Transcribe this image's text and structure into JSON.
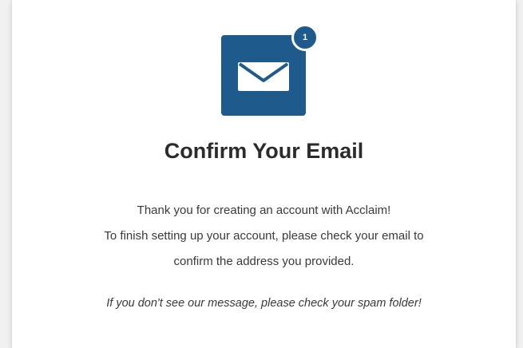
{
  "notification": {
    "icon": "envelope-icon",
    "badge_count": "1",
    "accent_color": "#1e5b8c"
  },
  "heading": "Confirm Your Email",
  "message_lines": [
    "Thank you for creating an account with Acclaim!",
    "To finish setting up your account, please check your email to",
    "confirm the address you provided."
  ],
  "spam_note": "If you don't see our message, please check your spam folder!"
}
